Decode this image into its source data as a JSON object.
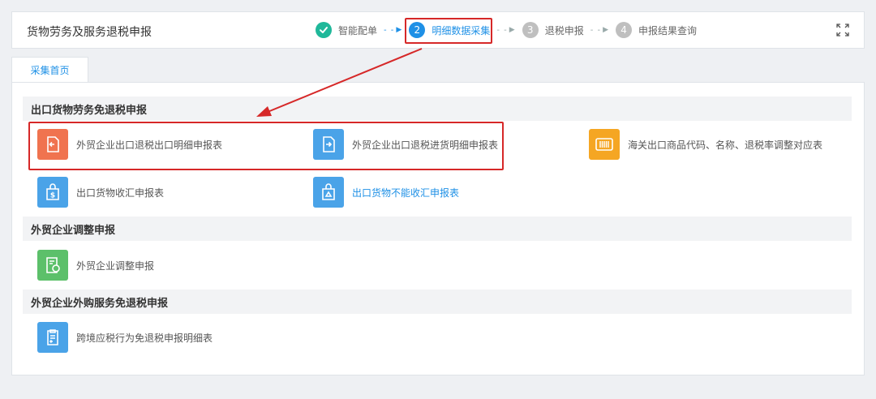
{
  "header": {
    "title": "货物劳务及服务退税申报",
    "steps": [
      {
        "num": "",
        "label": "智能配单",
        "state": "done"
      },
      {
        "num": "2",
        "label": "明细数据采集",
        "state": "active"
      },
      {
        "num": "3",
        "label": "退税申报",
        "state": "pending"
      },
      {
        "num": "4",
        "label": "申报结果查询",
        "state": "pending"
      }
    ]
  },
  "tabs": [
    {
      "label": "采集首页"
    }
  ],
  "sections": [
    {
      "title": "出口货物劳务免退税申报",
      "items": [
        {
          "label": "外贸企业出口退税出口明细申报表",
          "icon": "document-export-icon",
          "color": "#f0734f"
        },
        {
          "label": "外贸企业出口退税进货明细申报表",
          "icon": "document-import-icon",
          "color": "#4aa3e8"
        },
        {
          "label": "海关出口商品代码、名称、退税率调整对应表",
          "icon": "barcode-icon",
          "color": "#f5a623"
        },
        {
          "label": "出口货物收汇申报表",
          "icon": "receipt-bag-icon",
          "color": "#4aa3e8"
        },
        {
          "label": "出口货物不能收汇申报表",
          "icon": "bag-icon",
          "color": "#4aa3e8"
        }
      ]
    },
    {
      "title": "外贸企业调整申报",
      "items": [
        {
          "label": "外贸企业调整申报",
          "icon": "adjust-document-icon",
          "color": "#5cc06a"
        }
      ]
    },
    {
      "title": "外贸企业外购服务免退税申报",
      "items": [
        {
          "label": "跨境应税行为免退税申报明细表",
          "icon": "clipboard-icon",
          "color": "#4aa3e8"
        }
      ]
    }
  ]
}
